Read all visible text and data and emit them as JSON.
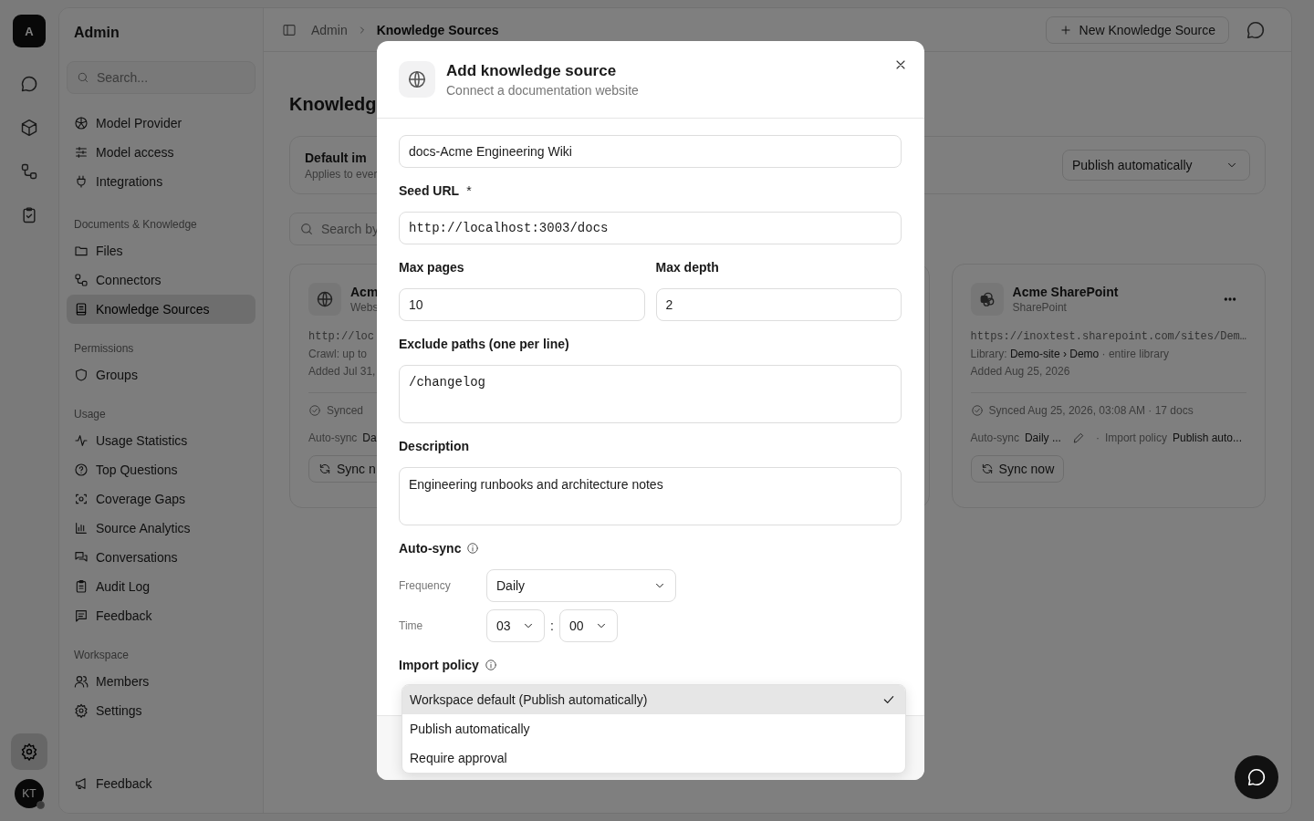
{
  "rail": {
    "logo": "A",
    "settings": {
      "selected": true
    },
    "avatar": "KT"
  },
  "sidebar": {
    "title": "Admin",
    "search": {
      "placeholder": "Search..."
    },
    "groups": [
      {
        "items": [
          {
            "label": "Model Provider",
            "selected": false
          },
          {
            "label": "Model access",
            "selected": false
          },
          {
            "label": "Integrations",
            "selected": false
          }
        ]
      },
      {
        "heading": "Documents & Knowledge",
        "items": [
          {
            "label": "Files",
            "selected": false
          },
          {
            "label": "Connectors",
            "selected": false
          },
          {
            "label": "Knowledge Sources",
            "selected": true
          }
        ]
      },
      {
        "heading": "Permissions",
        "items": [
          {
            "label": "Groups",
            "selected": false
          }
        ]
      },
      {
        "heading": "Usage",
        "items": [
          {
            "label": "Usage Statistics",
            "selected": false
          },
          {
            "label": "Top Questions",
            "selected": false
          },
          {
            "label": "Coverage Gaps",
            "selected": false
          },
          {
            "label": "Source Analytics",
            "selected": false
          },
          {
            "label": "Conversations",
            "selected": false
          },
          {
            "label": "Audit Log",
            "selected": false
          },
          {
            "label": "Feedback",
            "selected": false
          }
        ]
      },
      {
        "heading": "Workspace",
        "items": [
          {
            "label": "Members",
            "selected": false
          },
          {
            "label": "Settings",
            "selected": false
          }
        ]
      }
    ],
    "footer_item": "Feedback"
  },
  "header": {
    "breadcrumb": [
      "Admin",
      "Knowledge Sources"
    ],
    "new_button": "New Knowledge Source"
  },
  "page": {
    "title": "Knowledg",
    "default_import": {
      "title": "Default im",
      "subtitle": "Applies to ever",
      "value": "Publish automatically"
    },
    "search": {
      "placeholder": "Search by"
    },
    "cards": [
      {
        "kind": "website",
        "name": "Acm",
        "type": "Webs",
        "url": "http://loc",
        "lines": [
          "Crawl: up to",
          "Added Jul 31,"
        ],
        "synced": "Synced",
        "autosync_label": "Auto-sync",
        "autosync": "Da",
        "sync_button": "Sync n"
      },
      {
        "kind": "sharepoint",
        "name": "Acme SharePoint",
        "type": "SharePoint",
        "url": "https://inoxtest.sharepoint.com/sites/Dem…",
        "lines": [
          "Library: **Demo-site › Demo** · entire library",
          "Added Aug 25, 2026"
        ],
        "synced": "Synced Aug 25, 2026, 03:08 AM · 17 docs",
        "autosync_label": "Auto-sync",
        "autosync": "Daily ...",
        "separator": "·",
        "policy_label": "Import policy",
        "policy": "Publish auto...",
        "sync_button": "Sync now"
      }
    ]
  },
  "modal": {
    "title": "Add knowledge source",
    "subtitle": "Connect a documentation website",
    "name_value": "docs-Acme Engineering Wiki",
    "seed_url": {
      "label": "Seed URL",
      "required_mark": "*",
      "value": "http://localhost:3003/docs"
    },
    "max_pages": {
      "label": "Max pages",
      "value": "10"
    },
    "max_depth": {
      "label": "Max depth",
      "value": "2"
    },
    "exclude": {
      "label": "Exclude paths (one per line)",
      "value": "/changelog"
    },
    "description": {
      "label": "Description",
      "value": "Engineering runbooks and architecture notes"
    },
    "auto_sync": {
      "label": "Auto-sync",
      "frequency_label": "Frequency",
      "frequency": "Daily",
      "time_label": "Time",
      "hour": "03",
      "separator": ":",
      "minute": "00"
    },
    "import_policy": {
      "label": "Import policy",
      "options": [
        {
          "label": "Workspace default (Publish automatically)",
          "selected": true
        },
        {
          "label": "Publish automatically",
          "selected": false
        },
        {
          "label": "Require approval",
          "selected": false
        }
      ]
    }
  }
}
